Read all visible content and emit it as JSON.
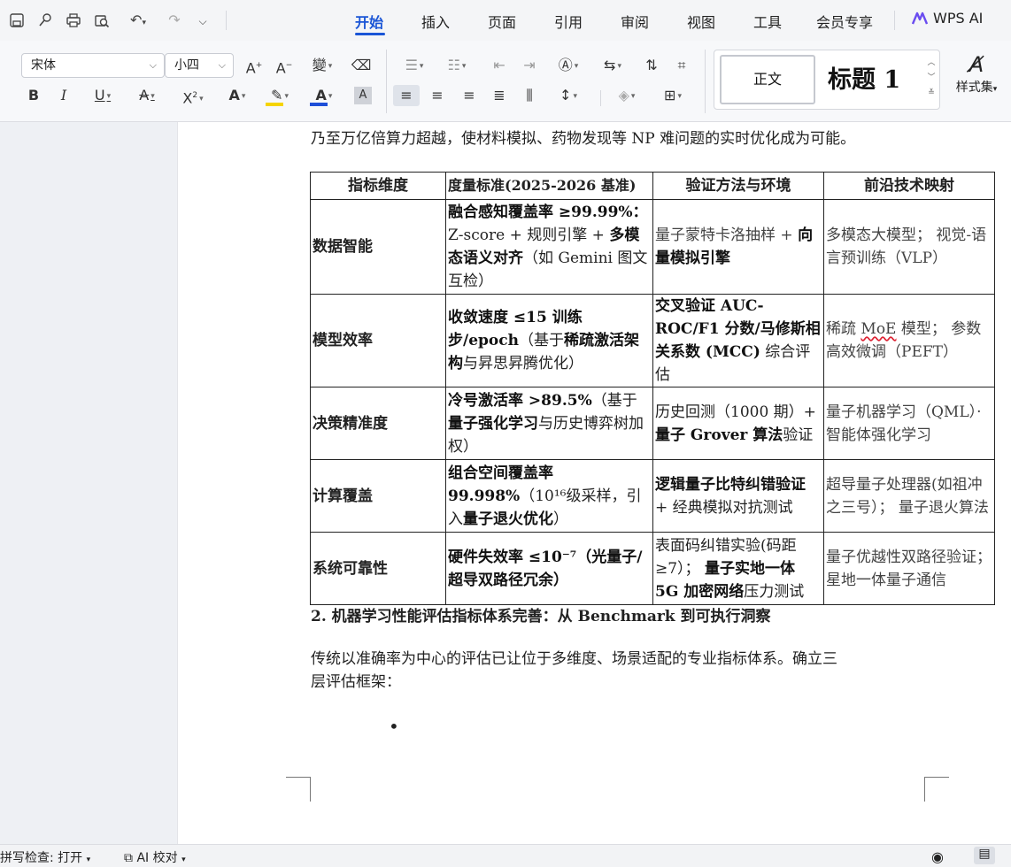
{
  "quick_access": {
    "icons": [
      "save-icon",
      "link-icon",
      "print-icon",
      "print-preview-icon",
      "undo-icon",
      "redo-icon",
      "more-icon"
    ]
  },
  "tabs": [
    {
      "label": "开始",
      "active": true
    },
    {
      "label": "插入",
      "active": false
    },
    {
      "label": "页面",
      "active": false
    },
    {
      "label": "引用",
      "active": false
    },
    {
      "label": "审阅",
      "active": false
    },
    {
      "label": "视图",
      "active": false
    },
    {
      "label": "工具",
      "active": false
    },
    {
      "label": "会员专享",
      "active": false
    }
  ],
  "wps_ai": {
    "label": "WPS AI"
  },
  "ribbon": {
    "font_name": "宋体",
    "font_size": "小四",
    "styles": {
      "normal": "正文",
      "heading1": "标题 1",
      "gallery_label": "样式集"
    }
  },
  "colors": {
    "accent": "#1a55d6",
    "highlight": "#f5d400",
    "font_color": "#1e4fd8"
  },
  "document": {
    "top_line": "乃至万亿倍算力超越，使材料模拟、药物发现等 NP 难问题的实时优化成为可能。",
    "table": {
      "headers": [
        "指标维度",
        "度量标准(2025-2026 基准)",
        "验证方法与环境",
        "前沿技术映射"
      ],
      "rows": [
        {
          "dim": "数据智能",
          "metric_bold": "融合感知覆盖率 ≥99.99%：",
          "metric_rest1": "Z-score + 规则引擎 + ",
          "metric_bold2": "多模态语义对齐",
          "metric_rest2": "（如 Gemini 图文互检）",
          "verify_normal": "量子蒙特卡洛抽样 + ",
          "verify_bold": "向量模拟引擎",
          "tech": "多模态大模型； 视觉-语言预训练（VLP）"
        },
        {
          "dim": "模型效率",
          "metric_bold": "收敛速度 ≤15 训练步/epoch",
          "metric_rest1": "（基于",
          "metric_bold2": "稀疏激活架构",
          "metric_rest2": "与昇思昇腾优化）",
          "verify_bold": "交叉验证 AUC-ROC/F1 分数/马修斯相关系数 (MCC)",
          "verify_normal": " 综合评估",
          "tech_pre": "稀疏 ",
          "tech_wavy": "MoE",
          "tech_post": " 模型； 参数高效微调（PEFT）"
        },
        {
          "dim": "决策精准度",
          "metric_bold": "冷号激活率 >89.5%",
          "metric_rest1": "（基于",
          "metric_bold2": "量子强化学习",
          "metric_rest2": "与历史博弈树加权）",
          "verify_normal": "历史回测（1000 期）+ ",
          "verify_bold": "量子 Grover 算法",
          "verify_normal2": "验证",
          "tech": "量子机器学习（QML）· 智能体强化学习"
        },
        {
          "dim": "计算覆盖",
          "metric_bold": "组合空间覆盖率 99.998%",
          "metric_rest1": "（10¹⁶级采样，引入",
          "metric_bold2": "量子退火优化",
          "metric_rest2": "）",
          "verify_bold": "逻辑量子比特纠错验证",
          "verify_normal": " + 经典模拟对抗测试",
          "tech": "超导量子处理器(如祖冲之三号）； 量子退火算法"
        },
        {
          "dim": "系统可靠性",
          "metric_bold": "硬件失效率 ≤10⁻⁷（光量子/超导双路径冗余）",
          "verify_normal": "表面码纠错实验(码距≥7）； ",
          "verify_bold": "量子实地一体 5G 加密网络",
          "verify_normal2": "压力测试",
          "tech": "量子优越性双路径验证； 星地一体量子通信"
        }
      ]
    },
    "heading2": "2.  机器学习性能评估指标体系完善：从 Benchmark 到可执行洞察",
    "para1_line1": "传统以准确率为中心的评估已让位于多维度、场景适配的专业指标体系。确立三",
    "para1_line2": "层评估框架：",
    "bullet": "•"
  },
  "statusbar": {
    "spellcheck": "拼写检查: 打开",
    "ai_check": "AI 校对"
  }
}
